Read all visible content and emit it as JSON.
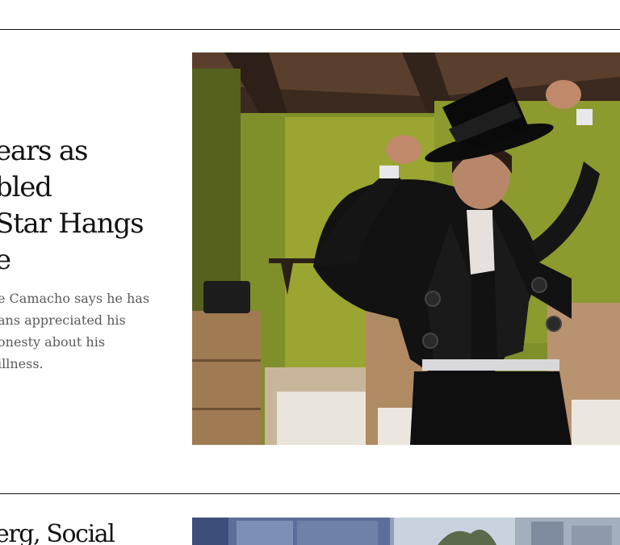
{
  "stories": [
    {
      "headline_lines": [
        "ears as",
        "bled",
        "Star Hangs",
        "e"
      ],
      "summary_lines": [
        "e Camacho says he has",
        "ans appreciated his",
        "onesty about his",
        "illness."
      ],
      "image_alt": "Man in traditional black velvet Spanish costume adjusting a black wide-brimmed hat in a green-walled room with wooden beams"
    },
    {
      "headline_lines": [
        "erg, Social"
      ],
      "image_alt": "City buildings with trees and blue window frames"
    }
  ],
  "colors": {
    "rule": "#121212",
    "headline": "#121212",
    "summary": "#5a5a5a",
    "wall_green": "#8a9a2a",
    "beam_brown": "#4a3324"
  }
}
